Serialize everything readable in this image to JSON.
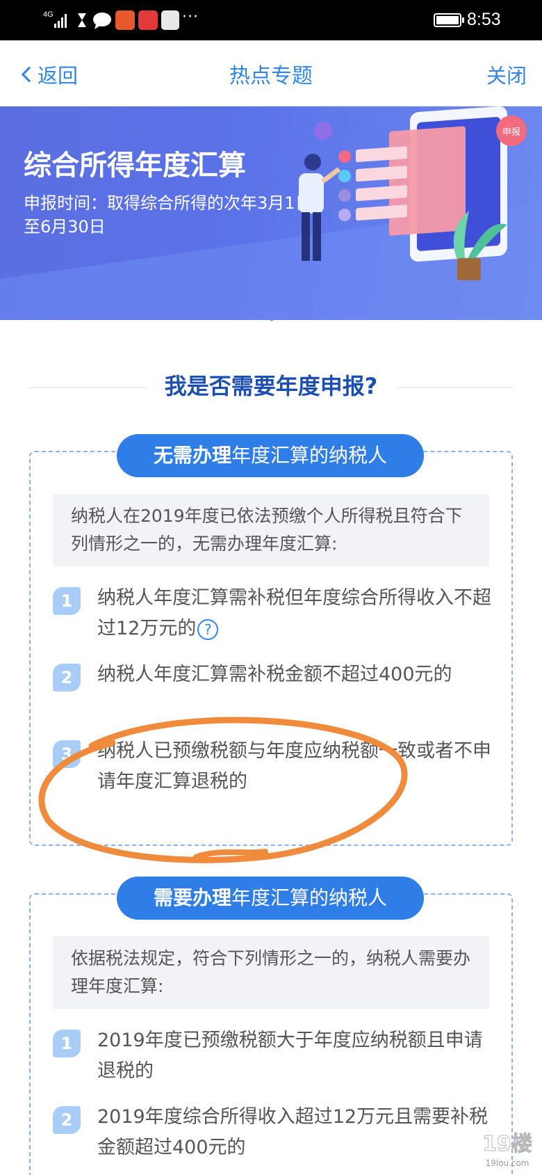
{
  "status_bar": {
    "signal_label": "4G",
    "time": "8:53",
    "overflow_dots": "···"
  },
  "nav": {
    "back_label": "返回",
    "title": "热点专题",
    "close_label": "关闭"
  },
  "banner": {
    "title": "综合所得年度汇算",
    "subtitle": "申报时间：取得综合所得的次年3月1日至6月30日",
    "badge": "申报"
  },
  "question_heading": "我是否需要年度申报?",
  "no_need_card": {
    "pill_bold": "无需办理",
    "pill_rest": "年度汇算的纳税人",
    "note": "纳税人在2019年度已依法预缴个人所得税且符合下列情形之一的，无需办理年度汇算:",
    "items": [
      {
        "num": "1",
        "text": "纳税人年度汇算需补税但年度综合所得收入不超过12万元的"
      },
      {
        "num": "2",
        "text": "纳税人年度汇算需补税金额不超过400元的"
      },
      {
        "num": "3",
        "text": "纳税人已预缴税额与年度应纳税额一致或者不申请年度汇算退税的"
      }
    ],
    "help_icon": "?"
  },
  "need_card": {
    "pill_bold": "需要办理",
    "pill_rest": "年度汇算的纳税人",
    "note": "依据税法规定，符合下列情形之一的，纳税人需要办理年度汇算:",
    "items": [
      {
        "num": "1",
        "text": "2019年度已预缴税额大于年度应纳税额且申请退税的"
      },
      {
        "num": "2",
        "text": "2019年度综合所得收入超过12万元且需要补税金额超过400元的"
      }
    ]
  },
  "colors": {
    "accent": "#2f86e8",
    "pill": "#2f7ee8",
    "heading": "#1d4fb3",
    "annotation": "#f08a3c"
  },
  "watermark": {
    "logo": "19楼",
    "url": "19lou.com"
  }
}
